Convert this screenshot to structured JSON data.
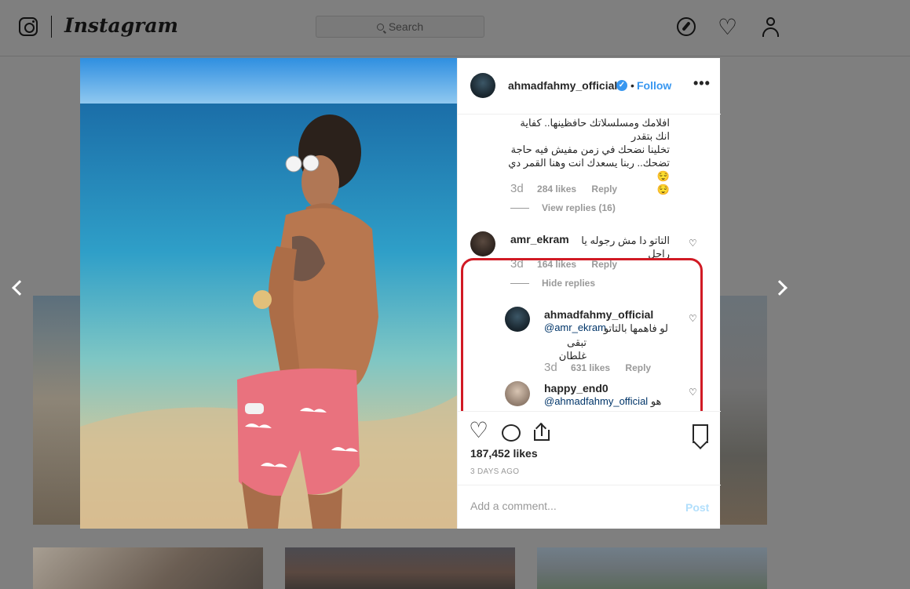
{
  "topbar": {
    "brand": "Instagram",
    "search_placeholder": "Search",
    "icons": [
      "instagram-camera-icon",
      "compass-icon",
      "heart-icon",
      "profile-icon"
    ]
  },
  "post": {
    "author": "ahmadfahmy_official",
    "follow_label": "Follow",
    "more_label": "•••",
    "likes_text": "187,452 likes",
    "date_text": "3 DAYS AGO",
    "add_comment_placeholder": "Add a comment...",
    "post_label": "Post"
  },
  "comments": [
    {
      "text_lines": [
        "افلامك ومسلسلاتك حافظينها.. كفاية انك بتقدر",
        "تخلينا نضحك في زمن مفيش فيه حاجة",
        "تضحك.. ربنا يسعدك انت وهنا القمر دي 😌",
        "😌"
      ],
      "time": "3d",
      "likes": "284 likes",
      "reply_label": "Reply",
      "replies_toggle": "View replies (16)"
    },
    {
      "user": "amr_ekram",
      "text": "التاتو دا مش رجوله يا راجل",
      "time": "3d",
      "likes": "164 likes",
      "reply_label": "Reply",
      "replies_toggle": "Hide replies",
      "reply": {
        "user": "ahmadfahmy_official",
        "mention": "@amr_ekram",
        "text_a": "لو فاهمها بالتاتو",
        "text_b": "تبقى غلطان",
        "time": "3d",
        "likes": "631 likes",
        "reply_label": "Reply"
      }
    },
    {
      "user": "happy_end0",
      "mention": "@ahmadfahmy_official",
      "text": "هو"
    }
  ],
  "colors": {
    "accent": "#3897f0",
    "highlight": "#d11a24",
    "overlay": "#7f7f7f"
  }
}
